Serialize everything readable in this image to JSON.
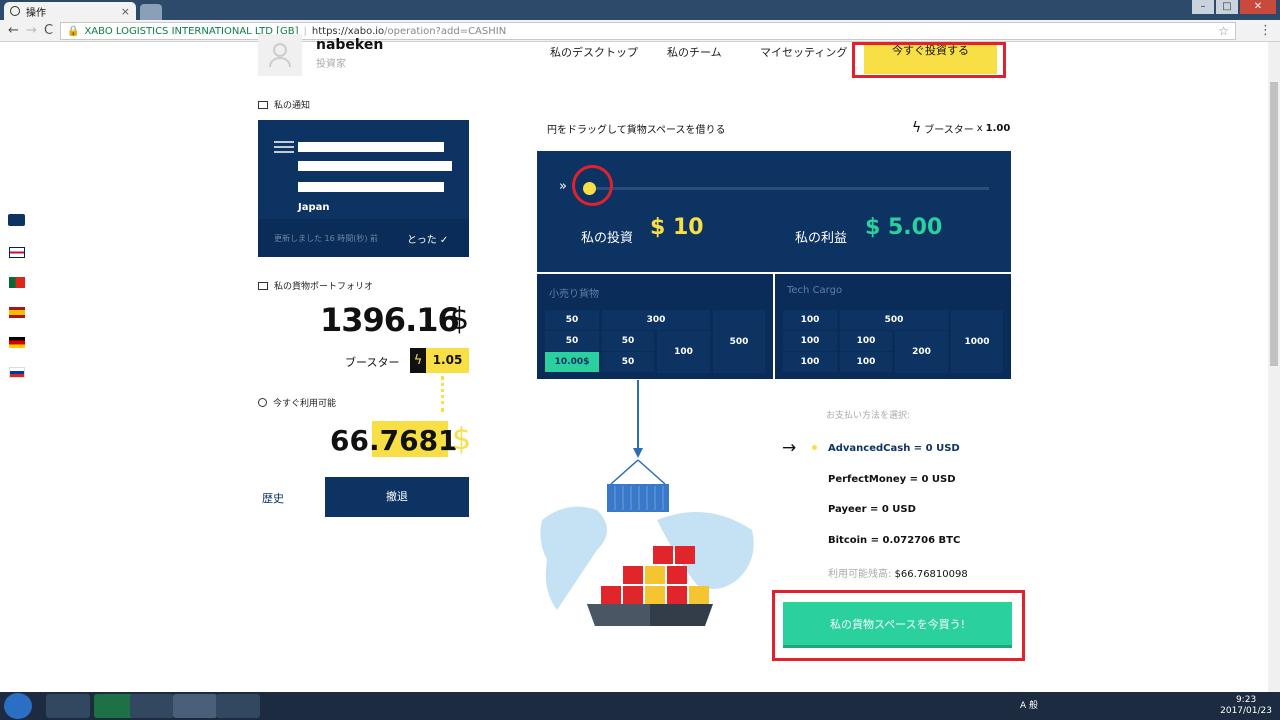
{
  "browser": {
    "tab_title": "操作",
    "tab_close": "×",
    "back": "←",
    "forward": "→",
    "reload": "C",
    "site_name": "XABO LOGISTICS INTERNATIONAL LTD [GB]",
    "url_host": "https://xabo.io",
    "url_path": "/operation?add=CASHIN",
    "bookmark": "☆",
    "menu": "⋮",
    "win_min": "–",
    "win_max": "□",
    "win_close": "✕"
  },
  "user": {
    "name": "nabeken",
    "role": "投資家"
  },
  "nav": {
    "desktop": "私のデスクトップ",
    "team": "私のチーム",
    "settings": "マイセッティング",
    "invest_now": "今すぐ投資する"
  },
  "notifications": {
    "title": "私の通知",
    "country": "Japan",
    "updated": "更新しました 16 時間(秒) 前",
    "took": "とった"
  },
  "portfolio": {
    "title": "私の貨物ポートフォリオ",
    "amount": "1396.16",
    "currency": "$",
    "booster_label": "ブースター",
    "booster_value": "1.05"
  },
  "available": {
    "title": "今すぐ利用可能",
    "int_part": "66.",
    "dec_part": "7681",
    "currency": "$"
  },
  "actions": {
    "history": "歴史",
    "withdraw": "撤退"
  },
  "slider": {
    "hint": "円をドラッグして貨物スペースを借りる",
    "booster_label": "ブースター",
    "booster_mult": "x",
    "booster_value": "1.00",
    "position": 0.0,
    "chevron": "»",
    "invest_label": "私の投資",
    "invest_value": "$ 10",
    "profit_label": "私の利益",
    "profit_value": "$ 5.00"
  },
  "cargo_retail": {
    "name": "小売り貨物",
    "cells": [
      "50",
      "300",
      "500",
      "50",
      "50",
      "100",
      "10.00$",
      "50"
    ]
  },
  "cargo_tech": {
    "name": "Tech Cargo",
    "cells": [
      "100",
      "500",
      "1000",
      "100",
      "100",
      "200",
      "100",
      "100"
    ]
  },
  "payment": {
    "header": "お支払い方法を選択:",
    "arrow": "→",
    "methods": [
      "AdvancedCash = 0 USD",
      "PerfectMoney = 0 USD",
      "Payeer = 0 USD",
      "Bitcoin = 0.072706 BTC"
    ],
    "balance_label": "利用可能残高:",
    "balance_value": "$66.76810098",
    "buy_button": "私の貨物スペースを今買う!"
  },
  "taskbar": {
    "tray_lang": "A 般",
    "time": "9:23",
    "date": "2017/01/23"
  },
  "colors": {
    "navy": "#0d3363",
    "yellow": "#f8df45",
    "green": "#2ad19e",
    "red": "#e2212d"
  }
}
